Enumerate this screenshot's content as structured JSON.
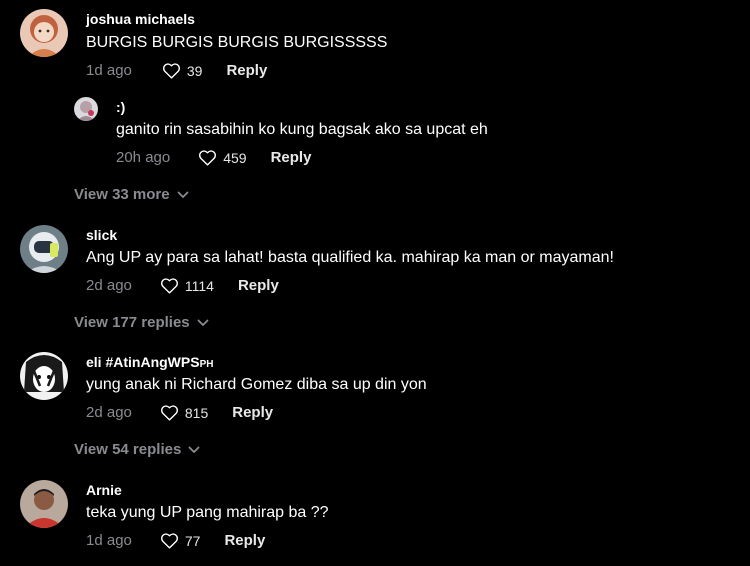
{
  "colors": {
    "background": "#000000",
    "text": "#ffffff",
    "muted": "#8a8b91"
  },
  "comments": [
    {
      "username": "joshua michaels",
      "text": "BURGIS BURGIS BURGIS BURGISSSSS",
      "time": "1d ago",
      "likes": "39",
      "reply_label": "Reply",
      "replies": [
        {
          "username": ":)",
          "text": "ganito rin sasabihin ko kung bagsak ako sa upcat eh",
          "time": "20h ago",
          "likes": "459",
          "reply_label": "Reply"
        }
      ],
      "view_more": "View 33 more"
    },
    {
      "username": "slick",
      "text": "Ang UP ay para sa lahat! basta qualified ka. mahirap ka man or mayaman!",
      "time": "2d ago",
      "likes": "1114",
      "reply_label": "Reply",
      "view_more": "View 177 replies"
    },
    {
      "username": "eli #AtinAngWPS",
      "username_suffix": "PH",
      "text": "yung anak ni Richard Gomez diba sa up din yon",
      "time": "2d ago",
      "likes": "815",
      "reply_label": "Reply",
      "view_more": "View 54 replies"
    },
    {
      "username": "Arnie",
      "text": "teka yung UP pang mahirap ba ??",
      "time": "1d ago",
      "likes": "77",
      "reply_label": "Reply"
    }
  ]
}
